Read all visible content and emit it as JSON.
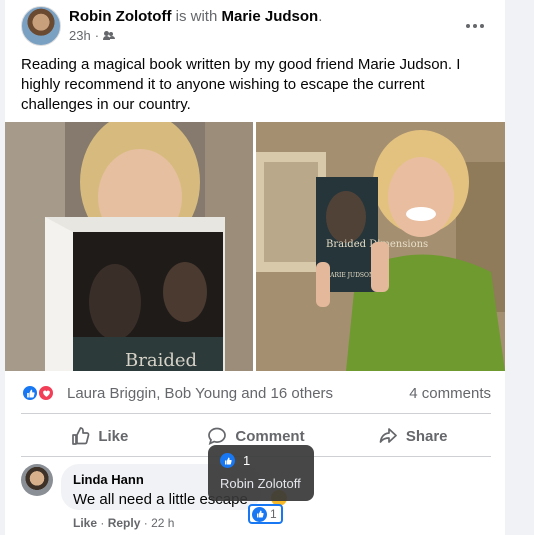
{
  "post": {
    "author": "Robin Zolotoff",
    "with_text": "is with",
    "tagged": "Marie Judson",
    "period": ".",
    "time": "23h",
    "separator": "·",
    "audience_icon": "friends-icon",
    "text": "Reading a magical book written by my good friend Marie Judson. I highly recommend it to anyone wishing to escape the current challenges in our country."
  },
  "photos": [
    {
      "name": "photo-woman-reading-book",
      "book_title": "Braided",
      "tone": "#6f6357"
    },
    {
      "name": "photo-woman-holding-book",
      "book_title": "Braided Dimensions",
      "book_author": "MARIE JUDSON",
      "tone": "#7b8b4a"
    }
  ],
  "reactions": {
    "icons": [
      "like-icon",
      "love-icon"
    ],
    "summary": "Laura Briggin, Bob Young and 16 others",
    "comments": "4 comments"
  },
  "actions": [
    {
      "label": "Like",
      "icon": "thumbs-up-icon"
    },
    {
      "label": "Comment",
      "icon": "comment-icon"
    },
    {
      "label": "Share",
      "icon": "share-icon"
    }
  ],
  "comment": {
    "author": "Linda Hann",
    "text": "We all need a little escape",
    "like_link": "Like",
    "reply_link": "Reply",
    "dot": "·",
    "time": "22 h",
    "like_count": "1"
  },
  "tooltip": {
    "count": "1",
    "name": "Robin Zolotoff"
  },
  "colors": {
    "facebook_blue": "#1877f2",
    "love_red": "#f33e58",
    "secondary_text": "#65676b",
    "divider": "#ced0d4"
  }
}
